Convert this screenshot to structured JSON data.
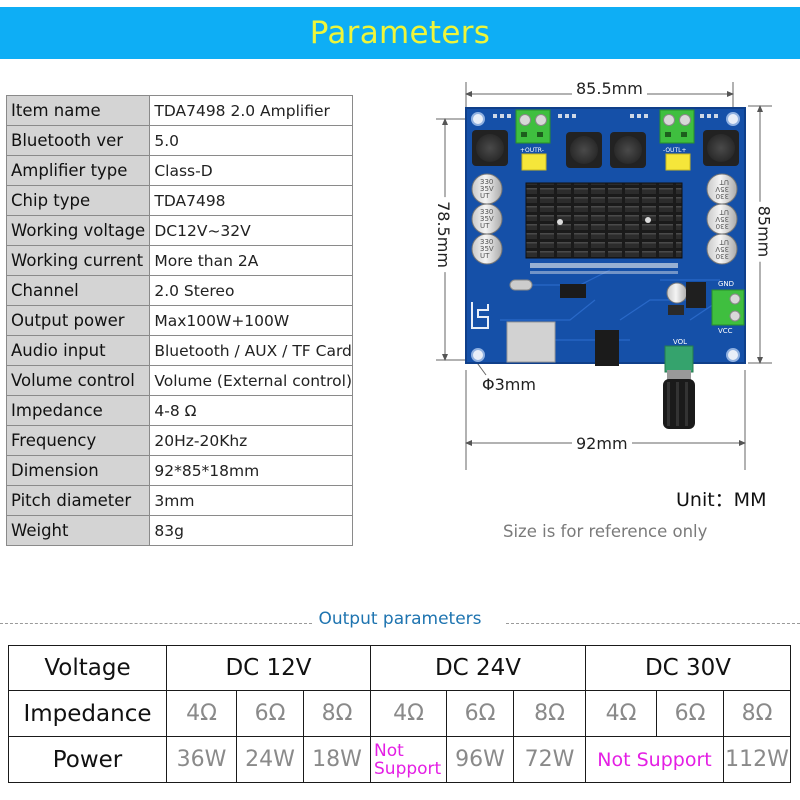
{
  "banner": {
    "title": "Parameters"
  },
  "specs": [
    {
      "label": "Item name",
      "value": "TDA7498  2.0 Amplifier"
    },
    {
      "label": "Bluetooth ver",
      "value": "5.0"
    },
    {
      "label": "Amplifier type",
      "value": "Class-D"
    },
    {
      "label": "Chip type",
      "value": "TDA7498"
    },
    {
      "label": "Working voltage",
      "value": "DC12V~32V"
    },
    {
      "label": "Working current",
      "value": "More than 2A"
    },
    {
      "label": "Channel",
      "value": "2.0  Stereo"
    },
    {
      "label": "Output power",
      "value": "Max100W+100W"
    },
    {
      "label": "Audio input",
      "value": "Bluetooth / AUX / TF Card"
    },
    {
      "label": "Volume control",
      "value": "Volume (External control)"
    },
    {
      "label": "Impedance",
      "value": "4-8 Ω"
    },
    {
      "label": "Frequency",
      "value": "20Hz-20Khz"
    },
    {
      "label": "Dimension",
      "value": "92*85*18mm"
    },
    {
      "label": "Pitch diameter",
      "value": "3mm"
    },
    {
      "label": "Weight",
      "value": "83g"
    }
  ],
  "diagram": {
    "width_top": "85.5mm",
    "height_left": "78.5mm",
    "height_right": "85mm",
    "width_bottom": "92mm",
    "hole_diameter": "Φ3mm",
    "unit": "Unit：MM",
    "note": "Size is for reference only",
    "board_labels": {
      "out_r": "+OUTR-",
      "out_l": "-OUTL+",
      "gnd": "GND",
      "vcc": "VCC",
      "vol": "VOL",
      "cap": [
        "330",
        "35V",
        "UT"
      ]
    }
  },
  "output": {
    "title": "Output parameters",
    "row_labels": {
      "voltage": "Voltage",
      "impedance": "Impedance",
      "power": "Power"
    },
    "groups": [
      {
        "voltage": "DC 12V",
        "impedances": [
          "4Ω",
          "6Ω",
          "8Ω"
        ],
        "power": [
          "36W",
          "24W",
          "18W"
        ]
      },
      {
        "voltage": "DC 24V",
        "impedances": [
          "4Ω",
          "6Ω",
          "8Ω"
        ],
        "power": [
          "Not Support",
          "96W",
          "72W"
        ]
      },
      {
        "voltage": "DC 30V",
        "impedances": [
          "4Ω",
          "6Ω",
          "8Ω"
        ],
        "power_merged": "Not Support",
        "power_last": "112W"
      }
    ],
    "colors": {
      "not_support": "#e41ee4",
      "title": "#1e74b0",
      "banner": "#0eaef5",
      "banner_text": "#eef53a"
    }
  }
}
